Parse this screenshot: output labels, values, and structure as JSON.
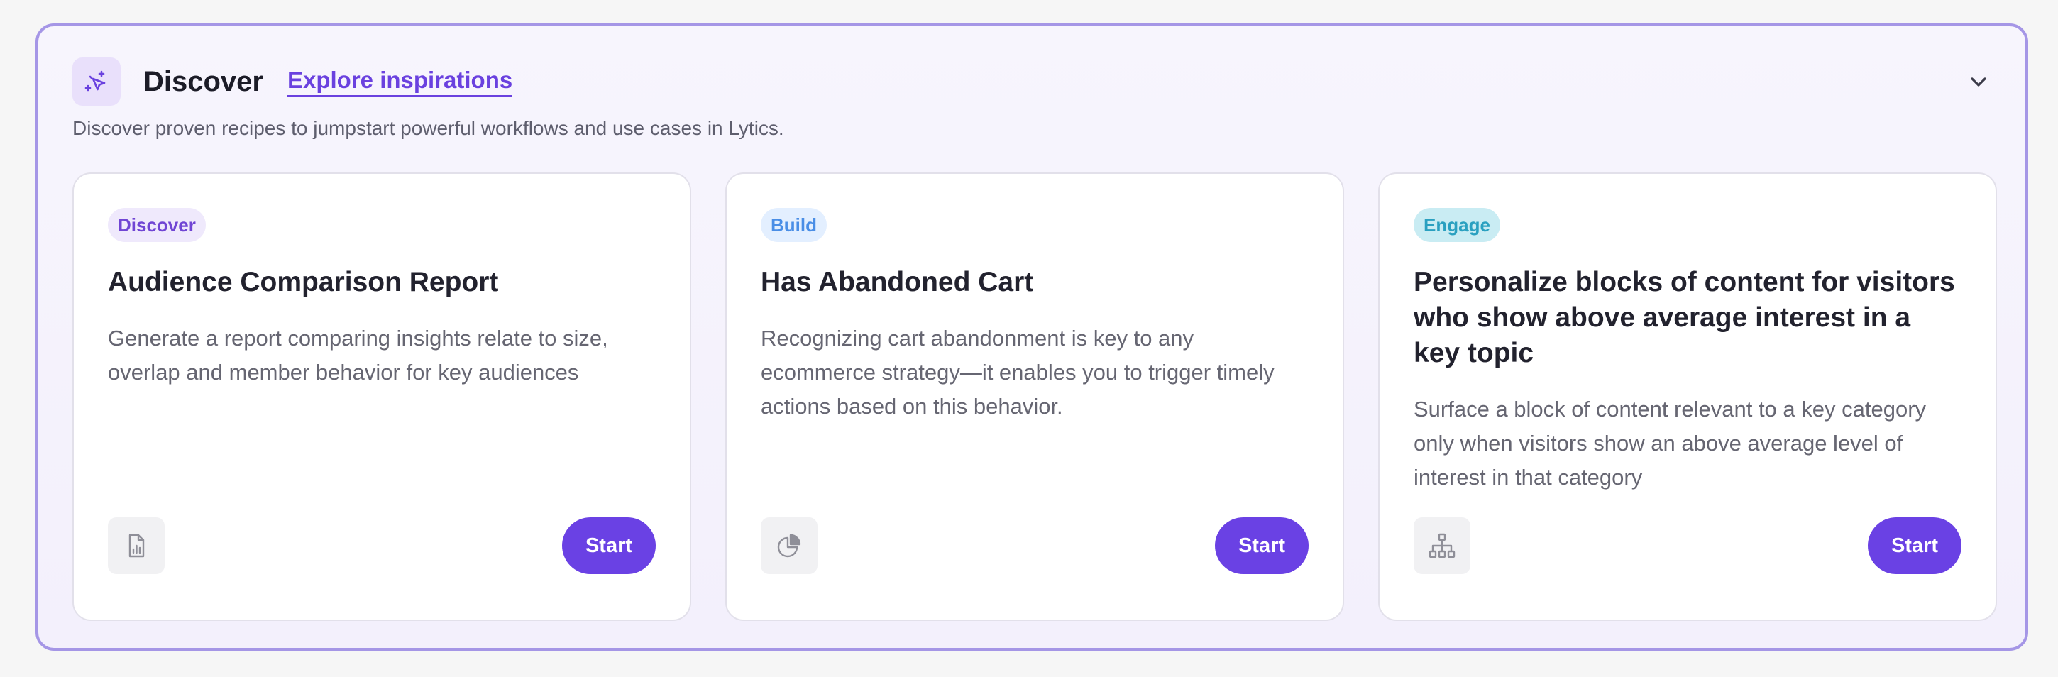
{
  "header": {
    "icon": "sparkle-cursor-icon",
    "title": "Discover",
    "link_label": "Explore inspirations",
    "subtitle": "Discover proven recipes to jumpstart powerful workflows and use cases in Lytics.",
    "collapse_icon": "chevron-down-icon"
  },
  "colors": {
    "accent": "#6a41e4",
    "panel_border": "#a596e6",
    "discover_badge_text": "#7045d4",
    "build_badge_text": "#4a8ee6",
    "engage_badge_text": "#2aa0c0"
  },
  "cards": [
    {
      "badge": "Discover",
      "title": "Audience Comparison Report",
      "description": "Generate a report comparing insights relate to size, overlap and member behavior for key audiences",
      "icon": "report-document-icon",
      "button": "Start"
    },
    {
      "badge": "Build",
      "title": "Has Abandoned Cart",
      "description": "Recognizing cart abandonment is key to any ecommerce strategy—it enables you to trigger timely actions based on this behavior.",
      "icon": "pie-chart-icon",
      "button": "Start"
    },
    {
      "badge": "Engage",
      "title": "Personalize blocks of content for visitors who show above average interest in a key topic",
      "description": "Surface a block of content relevant to a key category only when visitors show an above average level of interest in that category",
      "icon": "hierarchy-icon",
      "button": "Start"
    }
  ]
}
